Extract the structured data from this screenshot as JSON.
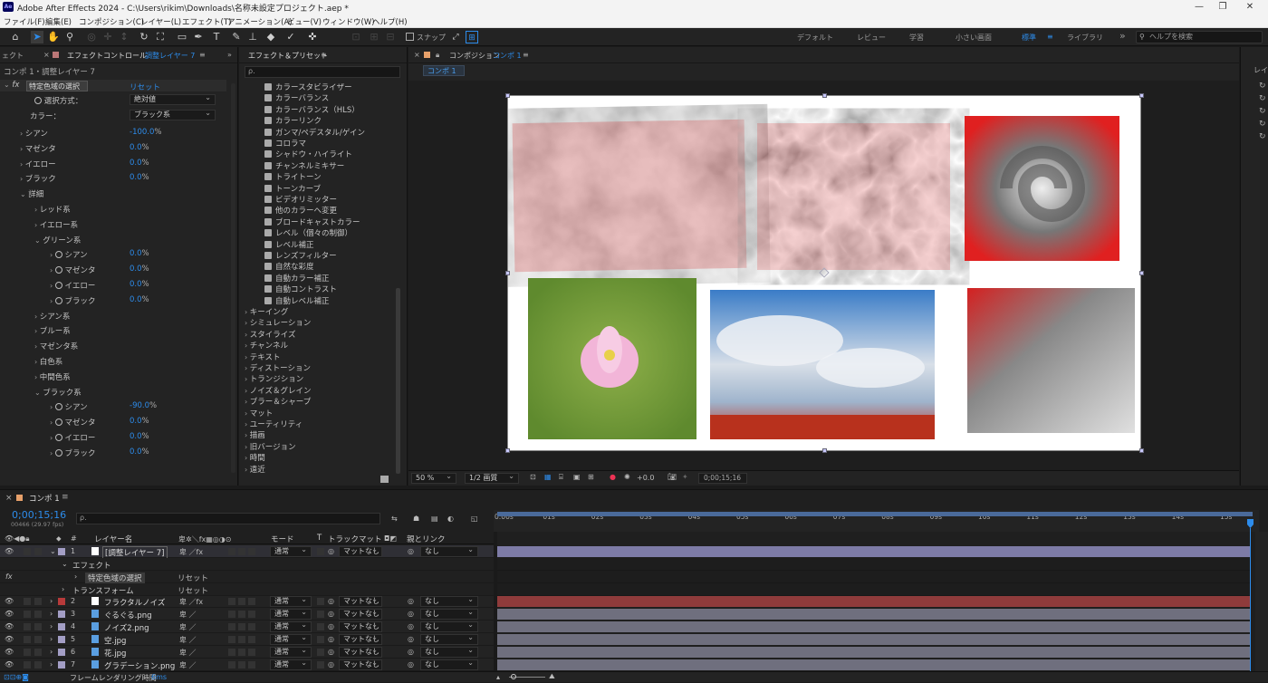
{
  "window": {
    "app_icon": "Ae",
    "title": "Adobe After Effects 2024 - C:\\Users\\rikim\\Downloads\\名称未設定プロジェクト.aep *",
    "minimize": "—",
    "maximize": "❐",
    "close": "✕"
  },
  "menu": [
    "ファイル(F)",
    "編集(E)",
    "コンポジション(C)",
    "レイヤー(L)",
    "エフェクト(T)",
    "アニメーション(A)",
    "ビュー(V)",
    "ウィンドウ(W)",
    "ヘルプ(H)"
  ],
  "toolbar": {
    "snap_label": "スナップ",
    "workspaces": [
      "デフォルト",
      "レビュー",
      "学習",
      "小さい画面",
      "標準",
      "ライブラリ"
    ],
    "active_workspace": "標準",
    "more": "»",
    "help_placeholder": "ヘルプを検索"
  },
  "effect_controls": {
    "tab_left": "ェクト",
    "tab": "エフェクトコントロール",
    "tab_layer": "調整レイヤー 7",
    "menu": "≡",
    "more": "»",
    "subtitle": "コンポ 1・調整レイヤー 7",
    "effect_name": "特定色域の選択",
    "fx_label": "fx",
    "reset": "リセット",
    "method_label": "選択方式：",
    "method_value": "絶対値",
    "color_label": "カラー：",
    "color_value": "ブラック系",
    "top_params": [
      {
        "name": "シアン",
        "value": "-100.0",
        "unit": "%"
      },
      {
        "name": "マゼンタ",
        "value": "0.0",
        "unit": "%"
      },
      {
        "name": "イエロー",
        "value": "0.0",
        "unit": "%"
      },
      {
        "name": "ブラック",
        "value": "0.0",
        "unit": "%"
      }
    ],
    "details": "詳細",
    "groups_a": [
      "レッド系",
      "イエロー系"
    ],
    "green": "グリーン系",
    "green_params": [
      {
        "name": "シアン",
        "value": "0.0",
        "unit": "%"
      },
      {
        "name": "マゼンタ",
        "value": "0.0",
        "unit": "%"
      },
      {
        "name": "イエロー",
        "value": "0.0",
        "unit": "%"
      },
      {
        "name": "ブラック",
        "value": "0.0",
        "unit": "%"
      }
    ],
    "groups_b": [
      "シアン系",
      "ブルー系",
      "マゼンタ系",
      "白色系",
      "中間色系"
    ],
    "black": "ブラック系",
    "black_params": [
      {
        "name": "シアン",
        "value": "-90.0",
        "unit": "%"
      },
      {
        "name": "マゼンタ",
        "value": "0.0",
        "unit": "%"
      },
      {
        "name": "イエロー",
        "value": "0.0",
        "unit": "%"
      },
      {
        "name": "ブラック",
        "value": "0.0",
        "unit": "%"
      }
    ]
  },
  "effects_presets": {
    "tab": "エフェクト＆プリセット",
    "menu": "≡",
    "search_placeholder": "ρ.",
    "items": [
      "カラースタビライザー",
      "カラーバランス",
      "カラーバランス（HLS）",
      "カラーリンク",
      "ガンマ/ペデスタル/ゲイン",
      "コロラマ",
      "シャドウ・ハイライト",
      "チャンネルミキサー",
      "トライトーン",
      "トーンカーブ",
      "ビデオリミッター",
      "他のカラーへ変更",
      "ブロードキャストカラー",
      "レベル（個々の制御）",
      "レベル補正",
      "レンズフィルター",
      "自然な彩度",
      "自動カラー補正",
      "自動コントラスト",
      "自動レベル補正"
    ],
    "categories": [
      "キーイング",
      "シミュレーション",
      "スタイライズ",
      "チャンネル",
      "テキスト",
      "ディストーション",
      "トランジション",
      "ノイズ＆グレイン",
      "ブラー＆シャープ",
      "マット",
      "ユーティリティ",
      "描画",
      "旧バージョン",
      "時間",
      "遠近"
    ]
  },
  "composition": {
    "tab_label": "コンポジション",
    "tab_name": "コンポ 1",
    "menu": "≡",
    "close": "×",
    "flow_tab": "コンポ 1",
    "zoom": "50 %",
    "resolution": "1/2 画質",
    "exposure": "+0.0",
    "timecode": "0;00;15;16",
    "right_panel_label": "レイ"
  },
  "timeline": {
    "tab": "コンポ 1",
    "menu": "≡",
    "close": "×",
    "timecode": "0;00;15;16",
    "fps": "00466 (29.97 fps)",
    "search_placeholder": "ρ.",
    "col_layer_name": "レイヤー名",
    "col_mode": "モード",
    "col_t": "T",
    "col_trackmatte": "トラックマット",
    "col_parent": "親とリンク",
    "ruler": [
      "0:00s",
      "01s",
      "02s",
      "03s",
      "04s",
      "05s",
      "06s",
      "07s",
      "08s",
      "09s",
      "10s",
      "11s",
      "12s",
      "13s",
      "14s",
      "15s"
    ],
    "layers": [
      {
        "num": "1",
        "name": "[調整レイヤー 7]",
        "mode": "通常",
        "matte": "マットなし",
        "parent": "なし",
        "color": "#a39ec5",
        "bar": "#7d7ba6",
        "icon": "white"
      },
      {
        "num": "2",
        "name": "フラクタルノイズ",
        "mode": "通常",
        "matte": "マットなし",
        "parent": "なし",
        "color": "#b73a3a",
        "bar": "#8f3b3b",
        "icon": "white"
      },
      {
        "num": "3",
        "name": "ぐるぐる.png",
        "mode": "通常",
        "matte": "マットなし",
        "parent": "なし",
        "color": "#a39ec5",
        "bar": "#6f6f7e",
        "icon": "file"
      },
      {
        "num": "4",
        "name": "ノイズ2.png",
        "mode": "通常",
        "matte": "マットなし",
        "parent": "なし",
        "color": "#a39ec5",
        "bar": "#6f6f7e",
        "icon": "file"
      },
      {
        "num": "5",
        "name": "空.jpg",
        "mode": "通常",
        "matte": "マットなし",
        "parent": "なし",
        "color": "#a39ec5",
        "bar": "#6f6f7e",
        "icon": "file"
      },
      {
        "num": "6",
        "name": "花.jpg",
        "mode": "通常",
        "matte": "マットなし",
        "parent": "なし",
        "color": "#a39ec5",
        "bar": "#6f6f7e",
        "icon": "file"
      },
      {
        "num": "7",
        "name": "グラデーション.png",
        "mode": "通常",
        "matte": "マットなし",
        "parent": "なし",
        "color": "#a39ec5",
        "bar": "#6f6f7e",
        "icon": "file"
      }
    ],
    "effect_group": "エフェクト",
    "effect_item": "特定色域の選択",
    "transform": "トランスフォーム",
    "reset": "リセット",
    "render_label": "フレームレンダリング時間",
    "render_value": "6ms"
  }
}
